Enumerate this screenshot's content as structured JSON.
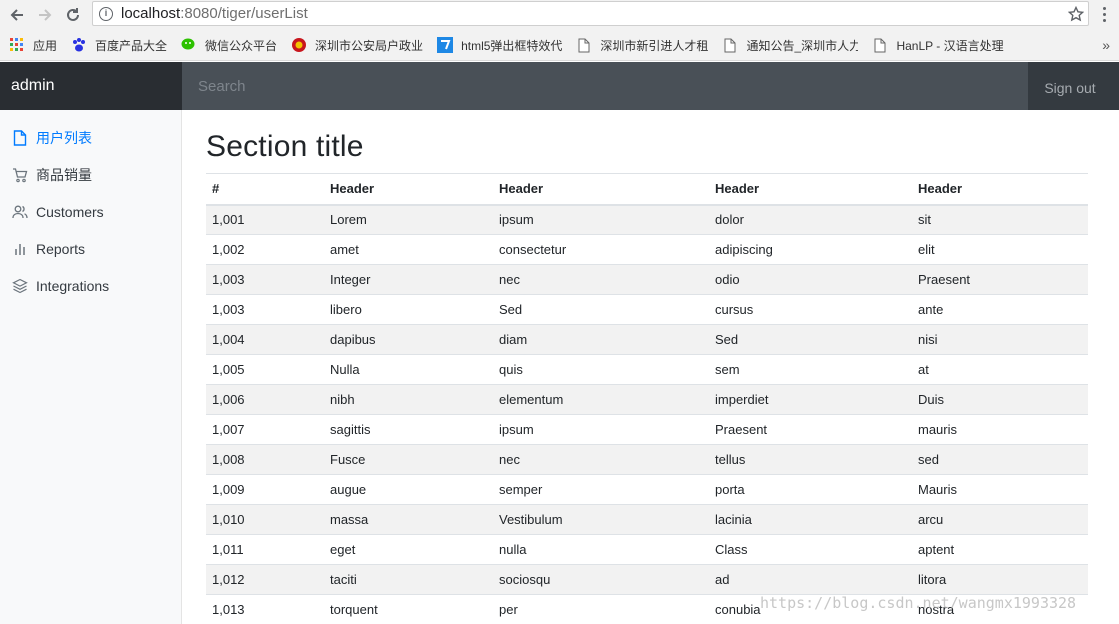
{
  "browser": {
    "url_host": "localhost",
    "url_path": ":8080/tiger/userList",
    "bookmarks": [
      {
        "label": "应用",
        "icon": "apps-grid-icon",
        "width": 0
      },
      {
        "label": "百度产品大全",
        "icon": "baidu-paw-icon"
      },
      {
        "label": "微信公众平台",
        "icon": "wechat-icon"
      },
      {
        "label": "深圳市公安局户政业",
        "icon": "police-badge-icon"
      },
      {
        "label": "html5弹出框特效代",
        "icon": "h5-icon"
      },
      {
        "label": "深圳市新引进人才租",
        "icon": "page-icon"
      },
      {
        "label": "通知公告_深圳市人力",
        "icon": "page-icon"
      },
      {
        "label": "HanLP - 汉语言处理",
        "icon": "page-icon"
      }
    ],
    "more_bookmarks": "»"
  },
  "navbar": {
    "brand": "admin",
    "search_placeholder": "Search",
    "signout": "Sign out"
  },
  "sidebar": {
    "items": [
      {
        "label": "用户列表",
        "icon": "file-icon",
        "active": true
      },
      {
        "label": "商品销量",
        "icon": "cart-icon"
      },
      {
        "label": "Customers",
        "icon": "users-icon"
      },
      {
        "label": "Reports",
        "icon": "bar-chart-icon"
      },
      {
        "label": "Integrations",
        "icon": "layers-icon"
      }
    ]
  },
  "main": {
    "title": "Section title",
    "table": {
      "headers": [
        "#",
        "Header",
        "Header",
        "Header",
        "Header"
      ],
      "rows": [
        [
          "1,001",
          "Lorem",
          "ipsum",
          "dolor",
          "sit"
        ],
        [
          "1,002",
          "amet",
          "consectetur",
          "adipiscing",
          "elit"
        ],
        [
          "1,003",
          "Integer",
          "nec",
          "odio",
          "Praesent"
        ],
        [
          "1,003",
          "libero",
          "Sed",
          "cursus",
          "ante"
        ],
        [
          "1,004",
          "dapibus",
          "diam",
          "Sed",
          "nisi"
        ],
        [
          "1,005",
          "Nulla",
          "quis",
          "sem",
          "at"
        ],
        [
          "1,006",
          "nibh",
          "elementum",
          "imperdiet",
          "Duis"
        ],
        [
          "1,007",
          "sagittis",
          "ipsum",
          "Praesent",
          "mauris"
        ],
        [
          "1,008",
          "Fusce",
          "nec",
          "tellus",
          "sed"
        ],
        [
          "1,009",
          "augue",
          "semper",
          "porta",
          "Mauris"
        ],
        [
          "1,010",
          "massa",
          "Vestibulum",
          "lacinia",
          "arcu"
        ],
        [
          "1,011",
          "eget",
          "nulla",
          "Class",
          "aptent"
        ],
        [
          "1,012",
          "taciti",
          "sociosqu",
          "ad",
          "litora"
        ],
        [
          "1,013",
          "torquent",
          "per",
          "conubia",
          "nostra"
        ]
      ]
    }
  },
  "watermark": "https://blog.csdn.net/wangmx1993328",
  "colors": {
    "navbar": "#343a40",
    "brand": "#292d32",
    "search": "#495057",
    "active": "#007bff",
    "sidebar": "#f8f9fa"
  }
}
